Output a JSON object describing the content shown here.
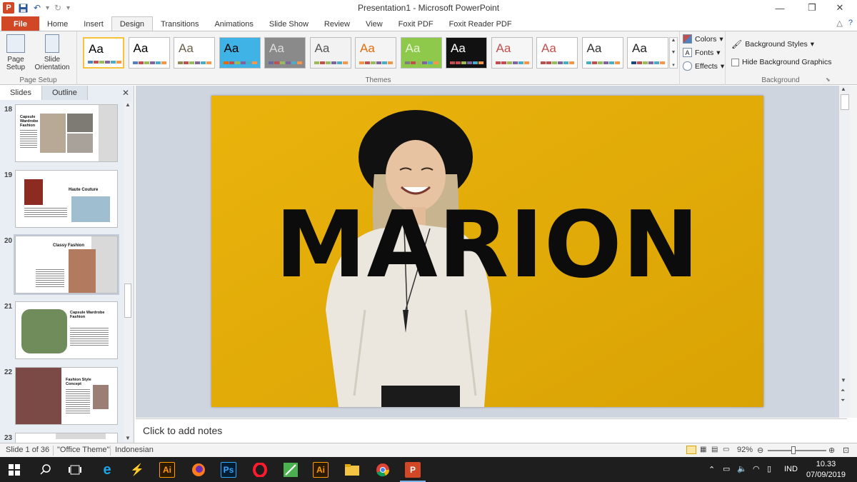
{
  "window": {
    "title": "Presentation1 - Microsoft PowerPoint",
    "app_icon_letter": "P",
    "controls": {
      "minimize": "—",
      "restore": "❐",
      "close": "✕"
    }
  },
  "ribbon_tabs": [
    "File",
    "Home",
    "Insert",
    "Design",
    "Transitions",
    "Animations",
    "Slide Show",
    "Review",
    "View",
    "Foxit PDF",
    "Foxit Reader PDF"
  ],
  "active_tab": "Design",
  "page_setup": {
    "page_setup_label": "Page Setup",
    "orientation_label": "Slide Orientation",
    "group_label": "Page Setup"
  },
  "themes": {
    "group_label": "Themes",
    "items": [
      {
        "name": "theme-office",
        "label": "Aa",
        "bg": "#ffffff",
        "fg": "#000000",
        "accent": "#4f81bd"
      },
      {
        "name": "theme-2",
        "label": "Aa",
        "bg": "#ffffff",
        "fg": "#000000",
        "accent": "#4f81bd"
      },
      {
        "name": "theme-3",
        "label": "Aa",
        "bg": "#ffffff",
        "fg": "#6b5e4b",
        "accent": "#938953"
      },
      {
        "name": "theme-4",
        "label": "Aa",
        "bg": "#3fb3e6",
        "fg": "#000000",
        "accent": "#e36c09"
      },
      {
        "name": "theme-5",
        "label": "Aa",
        "bg": "#8a8a8a",
        "fg": "#dddddd",
        "accent": "#6a6a9a"
      },
      {
        "name": "theme-6",
        "label": "Aa",
        "bg": "#f2f2f2",
        "fg": "#555555",
        "accent": "#9bbb59"
      },
      {
        "name": "theme-7",
        "label": "Aa",
        "bg": "#f4f4f4",
        "fg": "#e36c09",
        "accent": "#f79646"
      },
      {
        "name": "theme-8",
        "label": "Aa",
        "bg": "#8fc94c",
        "fg": "#e6f3d5",
        "accent": "#7f7f7f"
      },
      {
        "name": "theme-9",
        "label": "Aa",
        "bg": "#111111",
        "fg": "#ffffff",
        "accent": "#c0504d"
      },
      {
        "name": "theme-10",
        "label": "Aa",
        "bg": "#f6f6f6",
        "fg": "#c0504d",
        "accent": "#c0504d"
      },
      {
        "name": "theme-11",
        "label": "Aa",
        "bg": "#ffffff",
        "fg": "#c0504d",
        "accent": "#c0504d"
      },
      {
        "name": "theme-12",
        "label": "Aa",
        "bg": "#ffffff",
        "fg": "#333333",
        "accent": "#4bacc6"
      },
      {
        "name": "theme-13",
        "label": "Aa",
        "bg": "#ffffff",
        "fg": "#222222",
        "accent": "#1f497d"
      }
    ]
  },
  "theme_options": {
    "colors": "Colors",
    "fonts": "Fonts",
    "effects": "Effects"
  },
  "background": {
    "styles": "Background Styles",
    "hide_graphics": "Hide Background Graphics",
    "group_label": "Background"
  },
  "left_pane": {
    "tabs": [
      "Slides",
      "Outline"
    ],
    "close": "✕",
    "thumbnails": [
      {
        "num": "18",
        "title": "Capsule Wardrobe Fashion"
      },
      {
        "num": "19",
        "title": "Haute Couture"
      },
      {
        "num": "20",
        "title": "Classy Fashion"
      },
      {
        "num": "21",
        "title": "Capsule Wardrobe Fashion"
      },
      {
        "num": "22",
        "title": "Fashion Style Concept"
      },
      {
        "num": "23",
        "title": ""
      }
    ]
  },
  "slide": {
    "title": "MARION",
    "bg": "#e8b30a"
  },
  "notes_placeholder": "Click to add notes",
  "status": {
    "slide_info": "Slide 1 of 36",
    "theme": "\"Office Theme\"",
    "language": "Indonesian",
    "zoom": "92%"
  },
  "taskbar": {
    "lang": "IND",
    "time": "10.33",
    "date": "07/09/2019"
  }
}
